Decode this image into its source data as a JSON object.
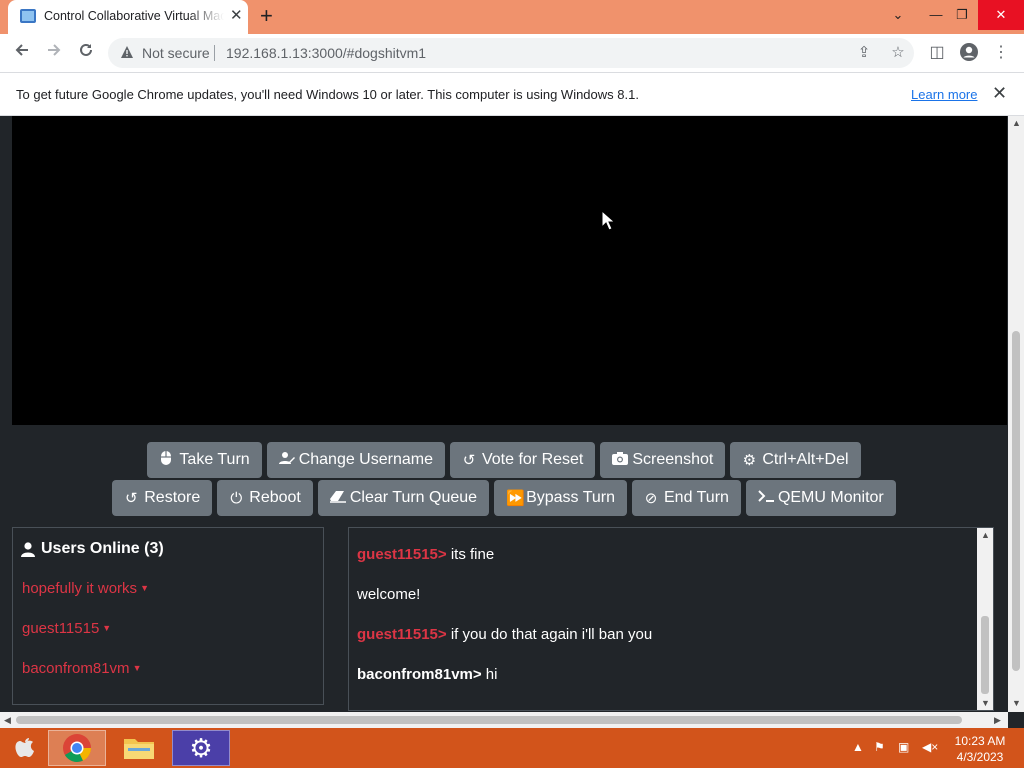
{
  "browser": {
    "tab_title": "Control Collaborative Virtual Machine",
    "new_tab": "+",
    "security_label": "Not secure",
    "url": "192.168.1.13:3000/#dogshitvm1",
    "info_message": "To get future Google Chrome updates, you'll need Windows 10 or later. This computer is using Windows 8.1.",
    "info_link": "Learn more"
  },
  "buttons_row1": [
    {
      "label": "Take Turn",
      "icon": "mouse-icon"
    },
    {
      "label": "Change Username",
      "icon": "user-edit-icon"
    },
    {
      "label": "Vote for Reset",
      "icon": "undo-icon"
    },
    {
      "label": "Screenshot",
      "icon": "camera-icon"
    },
    {
      "label": "Ctrl+Alt+Del",
      "icon": "gear-icon"
    }
  ],
  "buttons_row2": [
    {
      "label": "Restore",
      "icon": "restore-icon"
    },
    {
      "label": "Reboot",
      "icon": "power-icon"
    },
    {
      "label": "Clear Turn Queue",
      "icon": "eraser-icon"
    },
    {
      "label": "Bypass Turn",
      "icon": "fast-forward-icon"
    },
    {
      "label": "End Turn",
      "icon": "ban-icon"
    },
    {
      "label": "QEMU Monitor",
      "icon": "terminal-icon"
    }
  ],
  "users": {
    "heading": "Users Online (3)",
    "list": [
      "hopefully it works",
      "guest11515",
      "baconfrom81vm"
    ]
  },
  "chat": [
    {
      "user": "guest11515>",
      "text": " its fine",
      "style": "guest"
    },
    {
      "user": "",
      "text": "welcome!",
      "style": "system"
    },
    {
      "user": "guest11515>",
      "text": " if you do that again i'll ban you",
      "style": "guest"
    },
    {
      "user": "baconfrom81vm>",
      "text": " hi",
      "style": "self"
    }
  ],
  "taskbar": {
    "time": "10:23 AM",
    "date": "4/3/2023"
  },
  "colors": {
    "titlebar": "#f0926c",
    "taskbar": "#d2541b",
    "page_bg": "#212529",
    "button": "#6c757d",
    "username": "#dc3545"
  }
}
